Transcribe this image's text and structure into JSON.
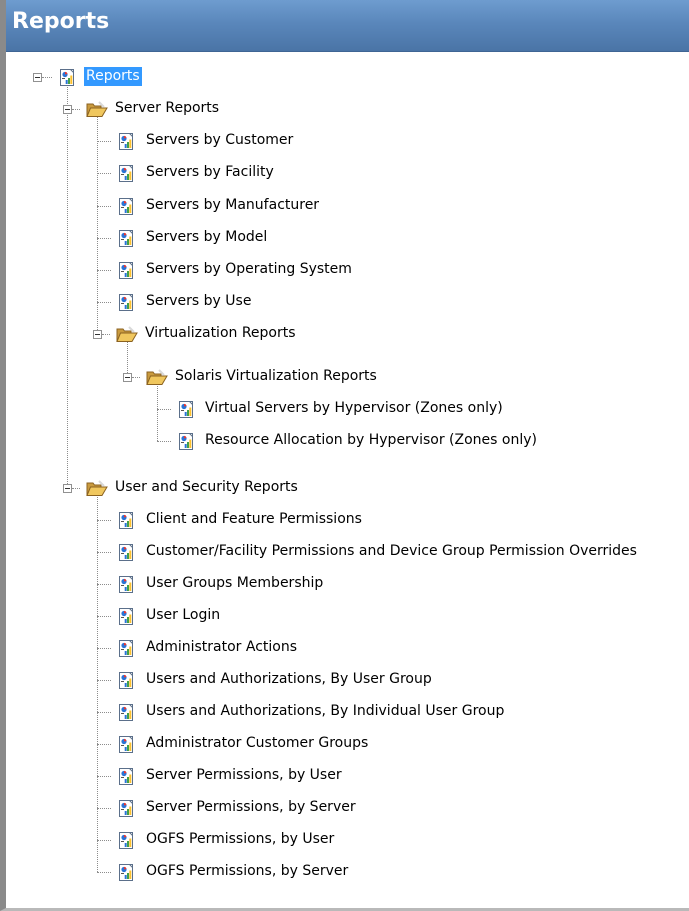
{
  "header": {
    "title": "Reports"
  },
  "tree": {
    "root": {
      "label": "Reports",
      "children": {
        "server_reports": {
          "label": "Server Reports",
          "items": [
            "Servers by Customer",
            "Servers by Facility",
            "Servers by Manufacturer",
            "Servers by Model",
            "Servers by Operating System",
            "Servers by Use"
          ],
          "virtualization": {
            "label": "Virtualization Reports",
            "solaris": {
              "label": "Solaris Virtualization Reports",
              "items": [
                "Virtual Servers by Hypervisor (Zones only)",
                "Resource Allocation by Hypervisor (Zones only)"
              ]
            }
          }
        },
        "user_security_reports": {
          "label": "User and Security Reports",
          "items": [
            "Client and Feature Permissions",
            "Customer/Facility Permissions and Device Group Permission Overrides",
            "User Groups Membership",
            "User Login",
            "Administrator Actions",
            "Users and Authorizations, By User Group",
            "Users and Authorizations, By Individual User Group",
            "Administrator Customer Groups",
            "Server Permissions, by User",
            "Server Permissions, by Server",
            "OGFS Permissions, by User",
            "OGFS Permissions, by Server"
          ]
        }
      }
    }
  }
}
